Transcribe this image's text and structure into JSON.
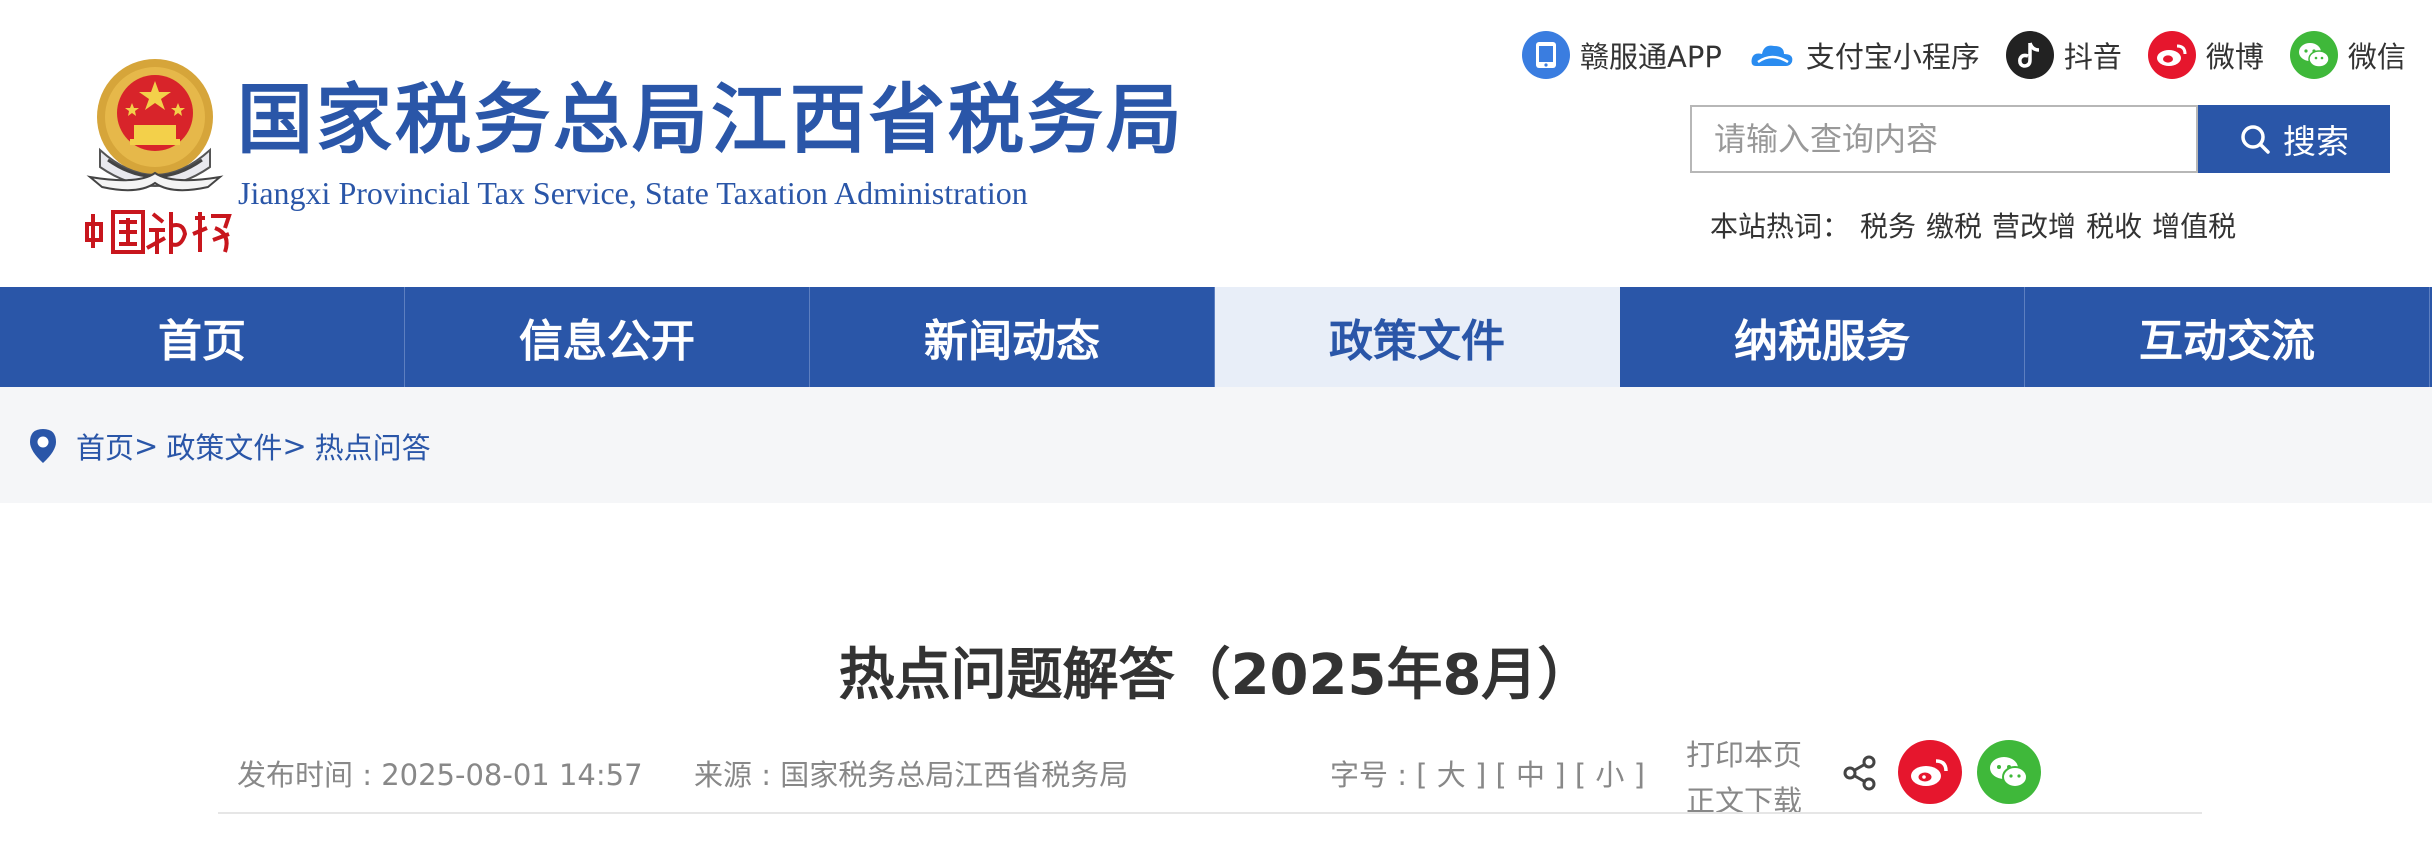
{
  "header": {
    "site_title": "国家税务总局江西省税务局",
    "site_subtitle": "Jiangxi Provincial Tax Service, State Taxation Administration",
    "seal_text": "中国税务",
    "app_links": [
      {
        "label": "赣服通APP",
        "icon": "phone-app-icon",
        "color": "#3a7de0"
      },
      {
        "label": "支付宝小程序",
        "icon": "cloud-icon",
        "color": "#2a8cf0"
      },
      {
        "label": "抖音",
        "icon": "douyin-icon",
        "color": "#222222"
      },
      {
        "label": "微博",
        "icon": "weibo-icon",
        "color": "#e6162d"
      },
      {
        "label": "微信",
        "icon": "wechat-icon",
        "color": "#3fb83a"
      }
    ],
    "search": {
      "placeholder": "请输入查询内容",
      "button_label": "搜索"
    },
    "hot": {
      "label": "本站热词：",
      "words": [
        "税务",
        "缴税",
        "营改增",
        "税收",
        "增值税"
      ]
    }
  },
  "nav": {
    "items": [
      {
        "label": "首页"
      },
      {
        "label": "信息公开"
      },
      {
        "label": "新闻动态"
      },
      {
        "label": "政策文件",
        "active": true
      },
      {
        "label": "纳税服务"
      },
      {
        "label": "互动交流"
      }
    ]
  },
  "breadcrumb": {
    "items": [
      "首页",
      "政策文件",
      "热点问答"
    ],
    "separator": ">"
  },
  "article": {
    "title": "热点问题解答（2025年8月）",
    "date": "发布时间 : 2025-08-01 14:57",
    "source": "来源 : 国家税务总局江西省税务局",
    "font_size_label": "字号 :",
    "font_size_options": [
      "[ 大 ]",
      "[ 中 ]",
      "[ 小 ]"
    ],
    "print_label": "打印本页",
    "download_label": "正文下载"
  },
  "colors": {
    "brand": "#2a56a8",
    "nav_active_bg": "#e8eef8",
    "weibo": "#e6162d",
    "wechat": "#3fb83a"
  }
}
